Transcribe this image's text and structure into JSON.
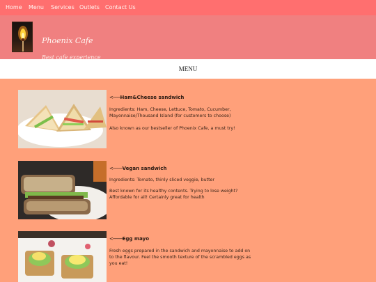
{
  "nav": {
    "links": [
      "Home",
      "Menu",
      "Services",
      "Outlets",
      "Contact Us"
    ]
  },
  "header": {
    "cafe_name": "Phoenix Cafe",
    "tagline": "Best cafe experience"
  },
  "menu_title": "MENU",
  "items": [
    {
      "arrow": "<-------",
      "name": "Ham&Cheese sandwich",
      "ingredients": "Ingredients: Ham, Cheese, Lettuce, Tomato, Cucumber, Mayonnaise/Thousand Island (for customers to choose)",
      "description": "Also known as our bestseller of Phoenix Cafe, a must try!"
    },
    {
      "arrow": "<---------",
      "name": "Vegan sandwich",
      "ingredients": "Ingredients: Tomato, thinly sliced veggie, butter",
      "description": "Best known for its healthy contents. Trying to lose weight? Affordable for all! Certainly great for health"
    },
    {
      "arrow": "<---------",
      "name": "Egg mayo",
      "ingredients": "Fresh eggs prepared in the sandwich and mayonnaise to add on to the flavour. Feel the smooth texture of the scrambled eggs as you eat!",
      "description": ""
    }
  ],
  "colors": {
    "navbar": "#ff6f6f",
    "header": "#f08080",
    "page_background": "#ffa07a",
    "menu_bar": "#ffffff"
  }
}
